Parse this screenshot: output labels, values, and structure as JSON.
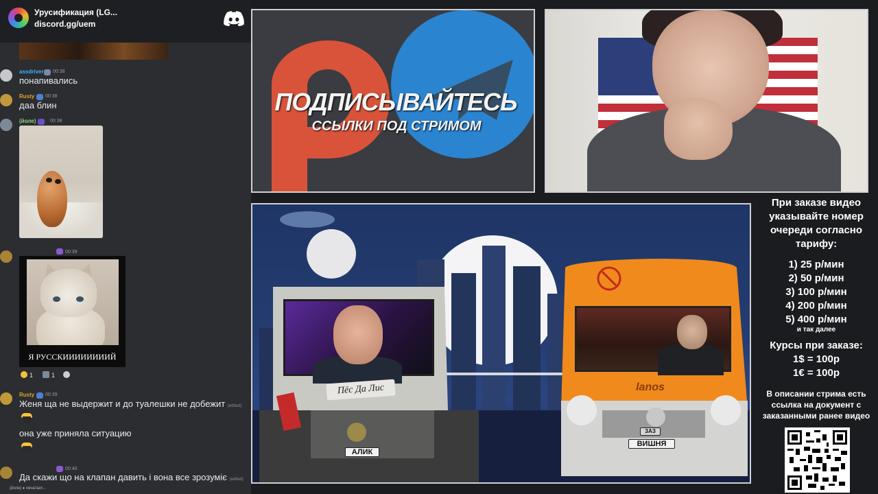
{
  "server": {
    "name": "Урусификация (LG...",
    "invite": "discord.gg/uem"
  },
  "messages": [
    {
      "user": "assdriver",
      "user_color": "#3ab0ff",
      "time": "00:38",
      "text": "понапивались"
    },
    {
      "user": "Rusty",
      "user_color": "#e0a51e",
      "time": "00:38",
      "text": "даа блин"
    },
    {
      "user": "(йоле)",
      "user_color": "#8ed37e",
      "time": "00:38"
    },
    {
      "user": "",
      "time": "00:39",
      "caption": "Я РУССКИИИИИИИИЙ",
      "reactions": [
        {
          "count": "1"
        },
        {
          "count": "1"
        }
      ]
    },
    {
      "user": "Rusty",
      "user_color": "#e0a51e",
      "time": "00:39",
      "text": "Женя ща не выдержит и до туалешки не добежит",
      "edited": "(edited)"
    },
    {
      "text": "она уже приняла ситуацию"
    },
    {
      "user": "",
      "time": "00:40",
      "text": "Да скажи що на клапан давить і вона все зрозуміє",
      "edited": "(edited)"
    }
  ],
  "typing": "(йоле) ♦ печатает...",
  "social_panel": {
    "headline": "ПОДПИСЫВАЙТЕСЬ",
    "subline": "ССЫЛКИ ПОД СТРИМОМ",
    "patreon_color": "#d9533a",
    "telegram_color": "#2a84d0"
  },
  "scene": {
    "truck_label": "Пёс Да Лис",
    "truck_plate": "АЛИК",
    "bus_brand": "lanos",
    "bus_plate": "ВИШНЯ",
    "bus_badge": "ЗАЗ"
  },
  "pricing": {
    "intro": "При заказе видео указывайте номер очереди согласно тарифу:",
    "prices": [
      "1) 25 р/мин",
      "2) 50 р/мин",
      "3) 100 р/мин",
      "4) 200 р/мин",
      "5) 400 р/мин"
    ],
    "more": "и так далее",
    "rates_title": "Курсы при заказе:",
    "rates": [
      "1$ = 100р",
      "1€ = 100р"
    ],
    "description_note": "В описании стрима есть ссылка на документ с заказанными ранее видео"
  }
}
